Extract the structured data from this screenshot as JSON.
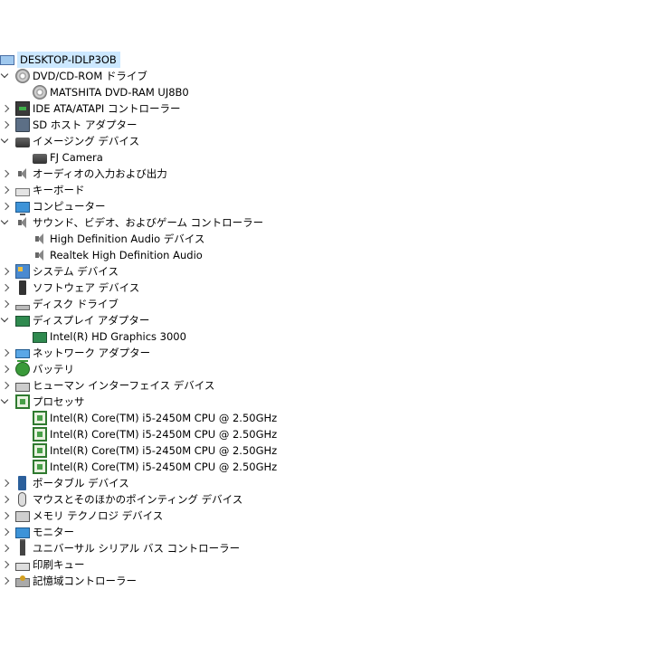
{
  "root": {
    "label": "DESKTOP-IDLP3OB",
    "icon": "computer-icon"
  },
  "nodes": [
    {
      "label": "DVD/CD-ROM ドライブ",
      "icon": "dvd-drive-icon",
      "expanded": true,
      "children": [
        {
          "label": "MATSHITA DVD-RAM UJ8B0",
          "icon": "dvd-drive-icon"
        }
      ]
    },
    {
      "label": "IDE ATA/ATAPI コントローラー",
      "icon": "ide-controller-icon",
      "expanded": false
    },
    {
      "label": "SD ホスト アダプター",
      "icon": "sd-host-icon",
      "expanded": false
    },
    {
      "label": "イメージング デバイス",
      "icon": "camera-icon",
      "expanded": true,
      "children": [
        {
          "label": "FJ Camera",
          "icon": "camera-icon"
        }
      ]
    },
    {
      "label": "オーディオの入力および出力",
      "icon": "speaker-icon",
      "expanded": false
    },
    {
      "label": "キーボード",
      "icon": "keyboard-icon",
      "expanded": false
    },
    {
      "label": "コンピューター",
      "icon": "monitor-icon",
      "expanded": false
    },
    {
      "label": "サウンド、ビデオ、およびゲーム コントローラー",
      "icon": "speaker-icon",
      "expanded": true,
      "children": [
        {
          "label": "High Definition Audio デバイス",
          "icon": "speaker-icon"
        },
        {
          "label": "Realtek High Definition Audio",
          "icon": "speaker-icon"
        }
      ]
    },
    {
      "label": "システム デバイス",
      "icon": "system-device-icon",
      "expanded": false
    },
    {
      "label": "ソフトウェア デバイス",
      "icon": "software-device-icon",
      "expanded": false
    },
    {
      "label": "ディスク ドライブ",
      "icon": "disk-drive-icon",
      "expanded": false
    },
    {
      "label": "ディスプレイ アダプター",
      "icon": "display-adapter-icon",
      "expanded": true,
      "children": [
        {
          "label": "Intel(R) HD Graphics 3000",
          "icon": "display-adapter-icon"
        }
      ]
    },
    {
      "label": "ネットワーク アダプター",
      "icon": "network-adapter-icon",
      "expanded": false
    },
    {
      "label": "バッテリ",
      "icon": "battery-icon",
      "expanded": false
    },
    {
      "label": "ヒューマン インターフェイス デバイス",
      "icon": "hid-icon",
      "expanded": false
    },
    {
      "label": "プロセッサ",
      "icon": "processor-icon",
      "expanded": true,
      "children": [
        {
          "label": "Intel(R) Core(TM) i5-2450M CPU @ 2.50GHz",
          "icon": "processor-icon"
        },
        {
          "label": "Intel(R) Core(TM) i5-2450M CPU @ 2.50GHz",
          "icon": "processor-icon"
        },
        {
          "label": "Intel(R) Core(TM) i5-2450M CPU @ 2.50GHz",
          "icon": "processor-icon"
        },
        {
          "label": "Intel(R) Core(TM) i5-2450M CPU @ 2.50GHz",
          "icon": "processor-icon"
        }
      ]
    },
    {
      "label": "ポータブル デバイス",
      "icon": "portable-device-icon",
      "expanded": false
    },
    {
      "label": "マウスとそのほかのポインティング デバイス",
      "icon": "mouse-icon",
      "expanded": false
    },
    {
      "label": "メモリ テクノロジ デバイス",
      "icon": "memory-icon",
      "expanded": false
    },
    {
      "label": "モニター",
      "icon": "monitor-icon",
      "expanded": false
    },
    {
      "label": "ユニバーサル シリアル バス コントローラー",
      "icon": "usb-icon",
      "expanded": false
    },
    {
      "label": "印刷キュー",
      "icon": "printer-icon",
      "expanded": false
    },
    {
      "label": "記憶域コントローラー",
      "icon": "storage-controller-icon",
      "expanded": false
    }
  ],
  "colors": {
    "selection": "#cce8ff"
  }
}
